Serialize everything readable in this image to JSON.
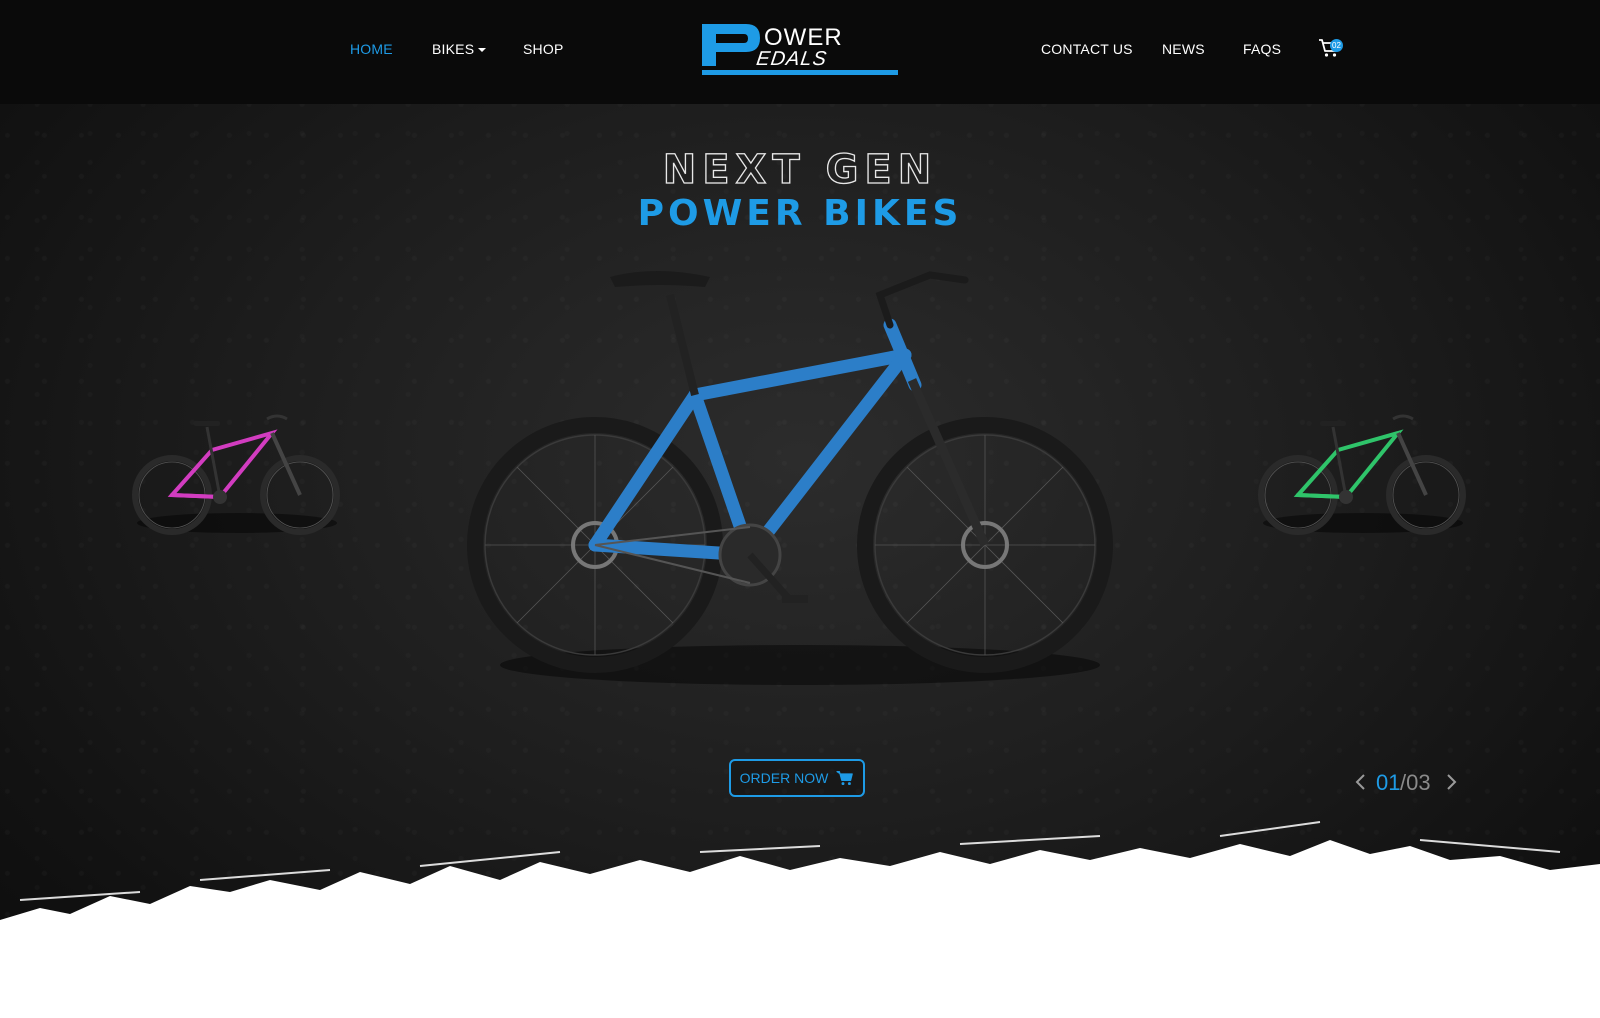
{
  "nav": {
    "left": [
      {
        "label": "HOME",
        "active": true
      },
      {
        "label": "BIKES",
        "dropdown": true
      },
      {
        "label": "SHOP"
      }
    ],
    "right": [
      {
        "label": "CONTACT US"
      },
      {
        "label": "NEWS"
      },
      {
        "label": "FAQS"
      }
    ],
    "cart_count": "02"
  },
  "logo": {
    "text": "Power Pedals"
  },
  "hero": {
    "line1": "NEXT GEN",
    "line2": "POWER BIKES",
    "order_label": "ORDER NOW",
    "pager_current": "01",
    "pager_total": "/03"
  },
  "bikes": [
    {
      "position": "left",
      "frame_color": "#d23cc0"
    },
    {
      "position": "center",
      "frame_color": "#2c7ec8"
    },
    {
      "position": "right",
      "frame_color": "#2fc46a"
    }
  ],
  "colors": {
    "accent": "#1e9be6",
    "background": "#1c1c1c",
    "nav_text": "#ffffff"
  }
}
